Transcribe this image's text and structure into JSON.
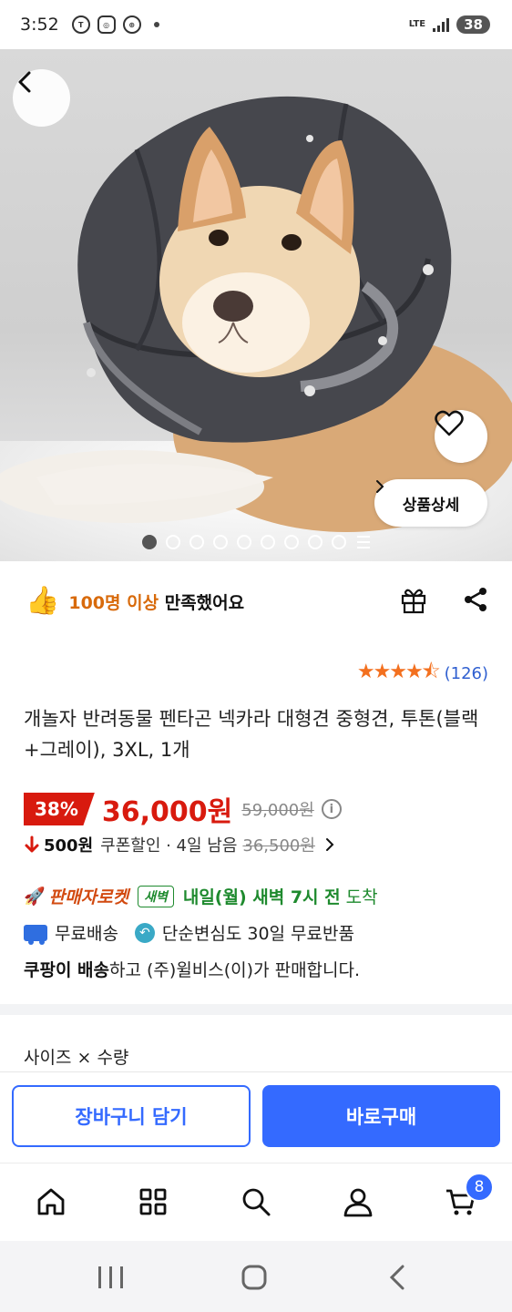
{
  "status_bar": {
    "time": "3:52",
    "network": "LTE",
    "battery": "38"
  },
  "product": {
    "satisfaction_highlight": "100명 이상",
    "satisfaction_rest": " 만족했어요",
    "review_count": "(126)",
    "title": "개놀자 반려동물 펜타곤 넥카라 대형견 중형견, 투톤(블랙+그레이), 3XL, 1개",
    "discount": "38%",
    "price": "36,000원",
    "original_price": "59,000원",
    "coupon_amount": "500원",
    "coupon_text": "쿠폰할인 · 4일 남음",
    "coupon_price": "36,500원",
    "rocket_label": "판매자로켓",
    "dawn_badge": "새벽",
    "arrival_bold": "내일(월) 새벽 7시 전",
    "arrival_rest": "도착",
    "free_shipping": "무료배송",
    "return_policy": "단순변심도 30일 무료반품",
    "seller_bold": "쿠팡이 배송",
    "seller_rest": "하고 (주)윌비스(이)가 판매합니다.",
    "option_label": "사이즈 × 수량"
  },
  "hero": {
    "detail_label": "상품상세",
    "image_count": 9,
    "active_image": 1
  },
  "buttons": {
    "cart": "장바구니 담기",
    "buy": "바로구매"
  },
  "nav": {
    "cart_count": "8"
  },
  "colors": {
    "accent": "#346aff",
    "price_red": "#d81a0e",
    "delivery_green": "#1e8a2e",
    "star_orange": "#f3701f"
  }
}
